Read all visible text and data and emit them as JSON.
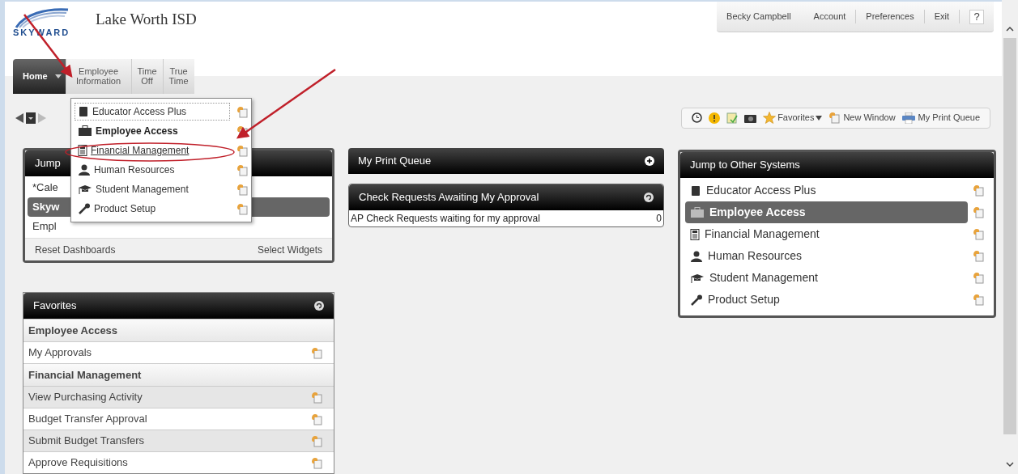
{
  "header": {
    "logo_text": "SKYWARD",
    "title": "Lake Worth ISD"
  },
  "user_menu": {
    "user": "Becky Campbell",
    "links": [
      "Account",
      "Preferences",
      "Exit"
    ],
    "help": "?"
  },
  "nav_tabs": [
    {
      "label": "Home",
      "selected": true
    },
    {
      "label": "Employee Information",
      "selected": false
    },
    {
      "label": "Time Off",
      "selected": false
    },
    {
      "label": "True Time",
      "selected": false
    }
  ],
  "toolbar": {
    "favorites": "Favorites",
    "new_window": "New Window",
    "print_queue": "My Print Queue"
  },
  "home_dropdown": {
    "items": [
      {
        "label": "Educator Access Plus",
        "selected": false,
        "focused": true,
        "circled": false
      },
      {
        "label": "Employee Access",
        "selected": true,
        "focused": false,
        "circled": false
      },
      {
        "label": "Financial Management",
        "selected": false,
        "focused": false,
        "circled": true
      },
      {
        "label": "Human Resources",
        "selected": false,
        "focused": false,
        "circled": false
      },
      {
        "label": "Student Management",
        "selected": false,
        "focused": false,
        "circled": false
      },
      {
        "label": "Product Setup",
        "selected": false,
        "focused": false,
        "circled": false
      }
    ]
  },
  "jump_widget": {
    "title": "Jump",
    "items": [
      {
        "label": "*Cale",
        "selected": false
      },
      {
        "label": "Skyw",
        "selected": true
      },
      {
        "label": "Empl",
        "selected": false
      }
    ],
    "footer_left": "Reset Dashboards",
    "footer_right": "Select Widgets"
  },
  "favorites_widget": {
    "title": "Favorites",
    "rows": [
      {
        "kind": "group",
        "label": "Employee Access"
      },
      {
        "kind": "link",
        "label": "My Approvals"
      },
      {
        "kind": "group",
        "label": "Financial Management"
      },
      {
        "kind": "link",
        "label": "View Purchasing Activity"
      },
      {
        "kind": "link",
        "label": "Budget Transfer Approval"
      },
      {
        "kind": "link",
        "label": "Submit Budget Transfers"
      },
      {
        "kind": "link",
        "label": "Approve Requisitions"
      }
    ]
  },
  "print_queue_widget": {
    "title": "My Print Queue"
  },
  "check_requests_widget": {
    "title": "Check Requests Awaiting My Approval",
    "rows": [
      {
        "label": "AP Check Requests waiting for my approval",
        "count": "0"
      }
    ]
  },
  "systems_widget": {
    "title": "Jump to Other Systems",
    "items": [
      {
        "label": "Educator Access Plus",
        "selected": false
      },
      {
        "label": "Employee Access",
        "selected": true
      },
      {
        "label": "Financial Management",
        "selected": false
      },
      {
        "label": "Human Resources",
        "selected": false
      },
      {
        "label": "Student Management",
        "selected": false
      },
      {
        "label": "Product Setup",
        "selected": false
      }
    ]
  }
}
